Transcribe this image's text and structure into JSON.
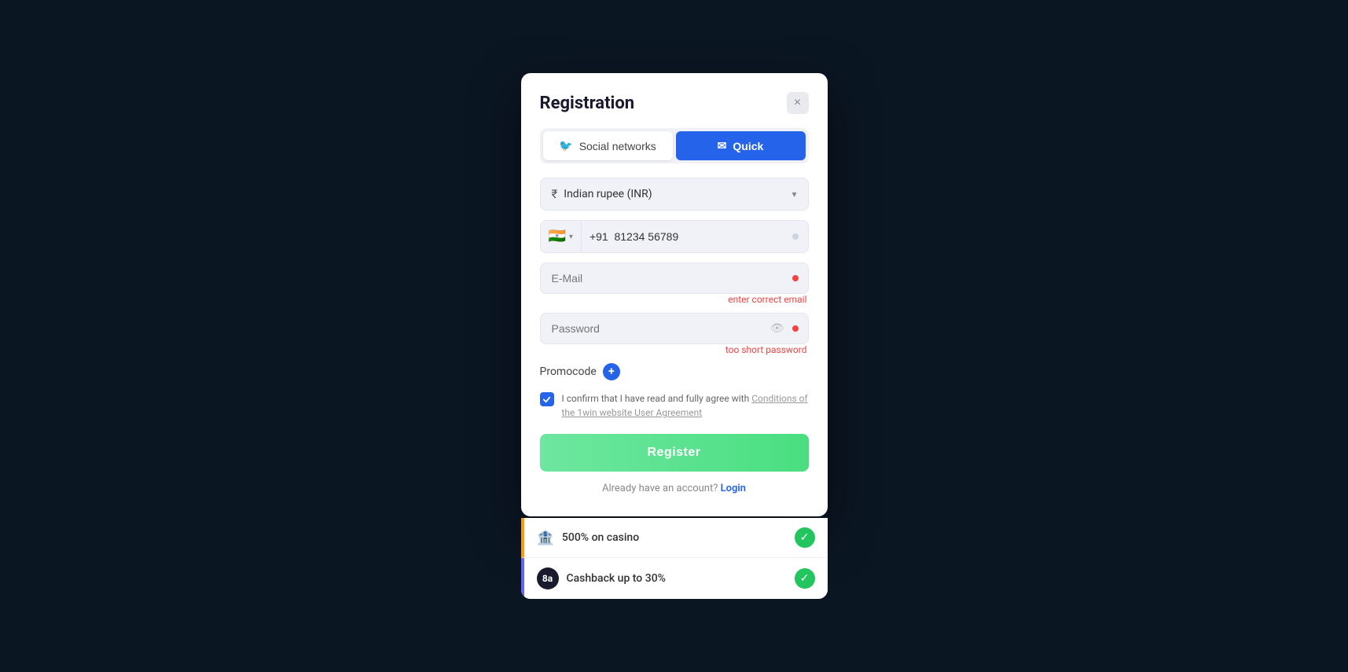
{
  "modal": {
    "title": "Registration",
    "close_label": "×",
    "tabs": {
      "social": "Social networks",
      "quick": "Quick"
    },
    "currency": {
      "label": "Indian rupee (INR)",
      "icon": "₹"
    },
    "phone": {
      "country_code": "+91",
      "placeholder": "81234 56789",
      "flag": "🇮🇳"
    },
    "email": {
      "placeholder": "E-Mail",
      "error": "enter correct email"
    },
    "password": {
      "placeholder": "Password",
      "error": "too short password"
    },
    "promocode": {
      "label": "Promocode",
      "add_icon": "+"
    },
    "checkbox": {
      "text_before": "I confirm that I have read and fully agree with ",
      "link_text": "Conditions of the 1win website User Agreement"
    },
    "register_button": "Register",
    "login_prompt": "Already have an account?",
    "login_link": "Login"
  },
  "bonuses": [
    {
      "icon": "🏦",
      "text": "500% on casino",
      "type": "casino"
    },
    {
      "icon_text": "8a",
      "text": "Cashback up to 30%",
      "type": "cashback"
    }
  ]
}
